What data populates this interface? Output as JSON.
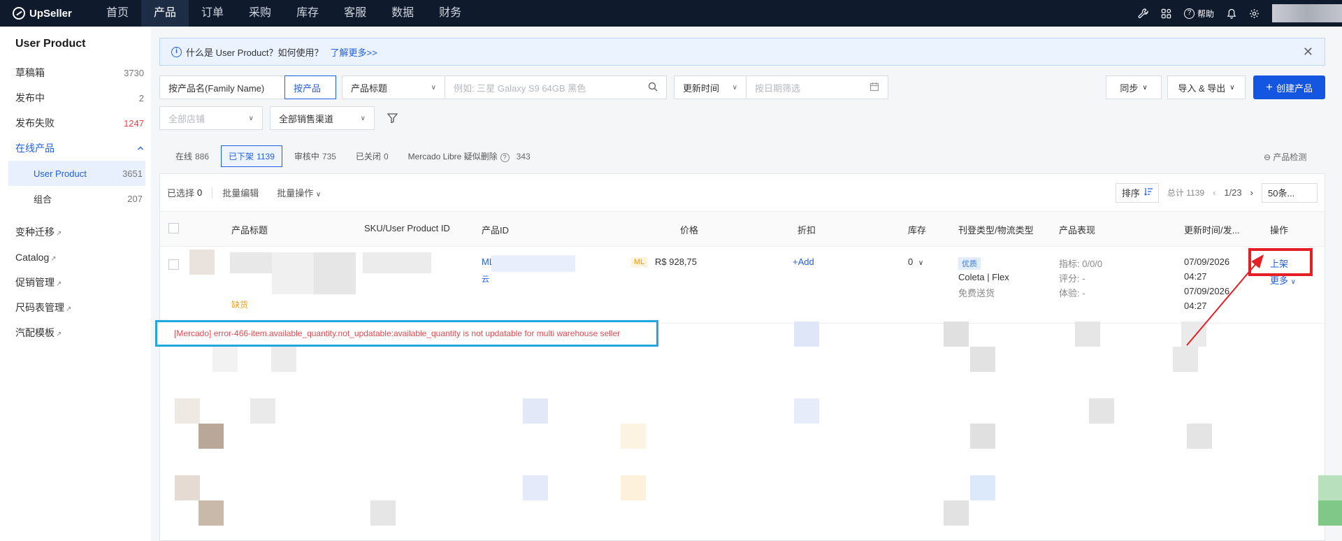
{
  "app": {
    "brand": "UpSeller"
  },
  "nav": {
    "items": [
      "首页",
      "产品",
      "订单",
      "采购",
      "库存",
      "客服",
      "数据",
      "财务"
    ],
    "active": "产品",
    "help_label": "帮助"
  },
  "sidebar": {
    "title": "User Product",
    "items": [
      {
        "label": "草稿箱",
        "count": "3730"
      },
      {
        "label": "发布中",
        "count": "2"
      },
      {
        "label": "发布失败",
        "count": "1247"
      },
      {
        "label": "在线产品",
        "count": ""
      },
      {
        "label": "User Product",
        "count": "3651"
      },
      {
        "label": "组合",
        "count": "207"
      }
    ],
    "links": [
      "变种迁移",
      "Catalog",
      "促销管理",
      "尺码表管理",
      "汽配模板"
    ]
  },
  "info": {
    "text": "什么是 User Product？如何使用？",
    "link": "了解更多>>"
  },
  "filters": {
    "family_name_tab": "按产品名(Family Name)",
    "product_tab": "按产品",
    "field_select": "产品标题",
    "search_placeholder": "例如: 三星 Galaxy S9 64GB 黑色",
    "time_select": "更新时间",
    "date_placeholder": "按日期筛选",
    "sync": "同步",
    "import_export": "导入 & 导出",
    "create": "创建产品",
    "store_select": "全部店铺",
    "channel_select": "全部销售渠道"
  },
  "tabs": [
    {
      "label": "在线",
      "count": "886"
    },
    {
      "label": "已下架",
      "count": "1139"
    },
    {
      "label": "审核中",
      "count": "735"
    },
    {
      "label": "已关闭",
      "count": "0"
    },
    {
      "label": "Mercado Libre 疑似删除",
      "count": "343"
    }
  ],
  "detect_label": "产品检测",
  "toolbar": {
    "selected_label": "已选择",
    "selected_count": "0",
    "batch_edit": "批量编辑",
    "batch_ops": "批量操作",
    "sort": "排序",
    "total": "总计 1139",
    "page": "1/23",
    "page_size": "50条..."
  },
  "columns": [
    "产品标题",
    "SKU/User Product ID",
    "产品ID",
    "价格",
    "折扣",
    "库存",
    "刊登类型/物流类型",
    "产品表现",
    "更新时间/发...",
    "操作"
  ],
  "row": {
    "stock_tag": "缺货",
    "product_id_prefix": "ML",
    "product_id_sub": "云",
    "price_badge": "ML",
    "price": "R$ 928,75",
    "discount": "+Add",
    "stock": "0",
    "listing_badge": "优质",
    "logistics": "Coleta | Flex",
    "shipping": "免费送货",
    "perf": [
      "指标: 0/0/0",
      "评分: -",
      "体验: -"
    ],
    "time1_date": "07/09/2026",
    "time1_clock": "04:27",
    "time2_date": "07/09/2026",
    "time2_clock": "04:27",
    "action_primary": "上架",
    "action_more": "更多"
  },
  "error_message": "[Mercado] error-466-item.available_quantity.not_updatable:available_quantity is not updatable for multi warehouse seller",
  "colors": {
    "primary": "#1456e0",
    "error": "#e5484d",
    "highlight": "#e41f25",
    "error_border": "#21a6e0"
  }
}
